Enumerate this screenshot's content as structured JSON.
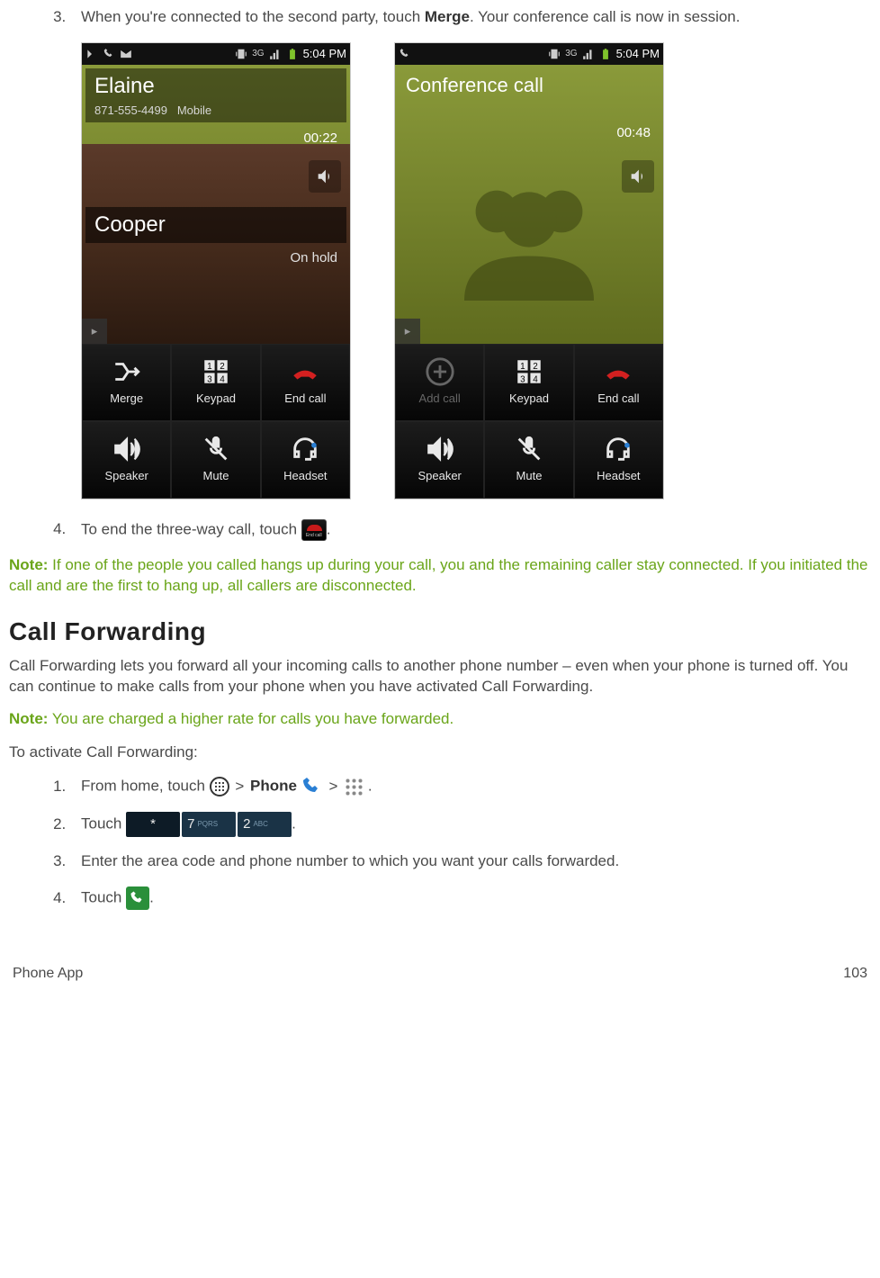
{
  "steps_top": {
    "step3_num": "3.",
    "step3_a": "When you're connected to the second party, touch ",
    "step3_b": "Merge",
    "step3_c": ". Your conference call is now in session.",
    "step4_num": "4.",
    "step4_a": "To end the three-way call, touch ",
    "step4_b": "."
  },
  "screens": {
    "status_time": "5:04 PM",
    "network_label": "3G",
    "left": {
      "caller1_name": "Elaine",
      "caller1_number": "871-555-4499",
      "caller1_type": "Mobile",
      "timer": "00:22",
      "caller2_name": "Cooper",
      "onhold": "On hold",
      "buttons": [
        "Merge",
        "Keypad",
        "End call",
        "Speaker",
        "Mute",
        "Headset"
      ]
    },
    "right": {
      "title": "Conference call",
      "timer": "00:48",
      "buttons": [
        "Add call",
        "Keypad",
        "End call",
        "Speaker",
        "Mute",
        "Headset"
      ]
    }
  },
  "note1_label": "Note:",
  "note1_text": " If one of the people you called hangs up during your call, you and the remaining caller stay connected. If you initiated the call and are the first to hang up, all callers are disconnected.",
  "section_heading": "Call Forwarding",
  "section_para": "Call Forwarding lets you forward all your incoming calls to another phone number – even when your phone is turned off. You can continue to make calls from your phone when you have activated Call Forwarding.",
  "note2_label": "Note:",
  "note2_text": " You are charged a higher rate for calls you have forwarded.",
  "activate_line": "To activate Call Forwarding:",
  "steps_bottom": {
    "s1_num": "1.",
    "s1_a": "From home, touch ",
    "s1_b": " > ",
    "s1_phone": "Phone",
    "s1_c": " > ",
    "s1_d": " .",
    "s2_num": "2.",
    "s2_a": "Touch ",
    "s2_b": ".",
    "key_star": "*",
    "key_7": "7",
    "key_7_sub": "PQRS",
    "key_2": "2",
    "key_2_sub": "ABC",
    "s3_num": "3.",
    "s3_text": "Enter the area code and phone number to which you want your calls forwarded.",
    "s4_num": "4.",
    "s4_a": "Touch ",
    "s4_b": "."
  },
  "footer": {
    "left": "Phone App",
    "right": "103"
  }
}
